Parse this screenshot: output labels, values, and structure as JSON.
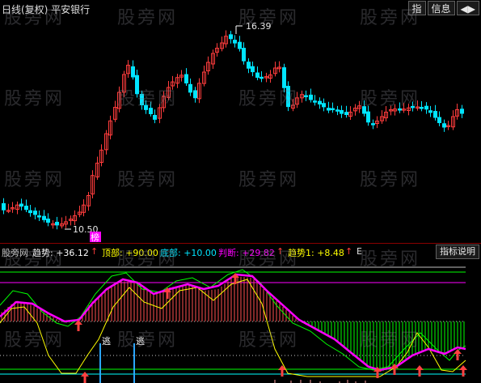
{
  "header": {
    "title": "日线(复权) 平安银行",
    "btn_index": "指",
    "btn_info": "信息",
    "btn_arrows": "◀▶"
  },
  "price": {
    "high_label": "16.39",
    "low_label": "10.50",
    "marker_text": "榜"
  },
  "indicator": {
    "name": "股旁网",
    "trend_label": "趋势: +36.12",
    "top_label": "顶部: +90.00",
    "bottom_label": "底部: +10.00",
    "judge_label": "判断: +29.82",
    "trend1_label": "趋势1: +8.48",
    "trailing": "E",
    "help_button": "指标说明",
    "escape_label": "逃"
  },
  "watermark": "股旁网",
  "colors": {
    "up": "#ff3c3c",
    "down": "#00e5ff",
    "trend_line": "#ff00ff",
    "green": "#00ff00",
    "yellow": "#ffff00"
  }
}
